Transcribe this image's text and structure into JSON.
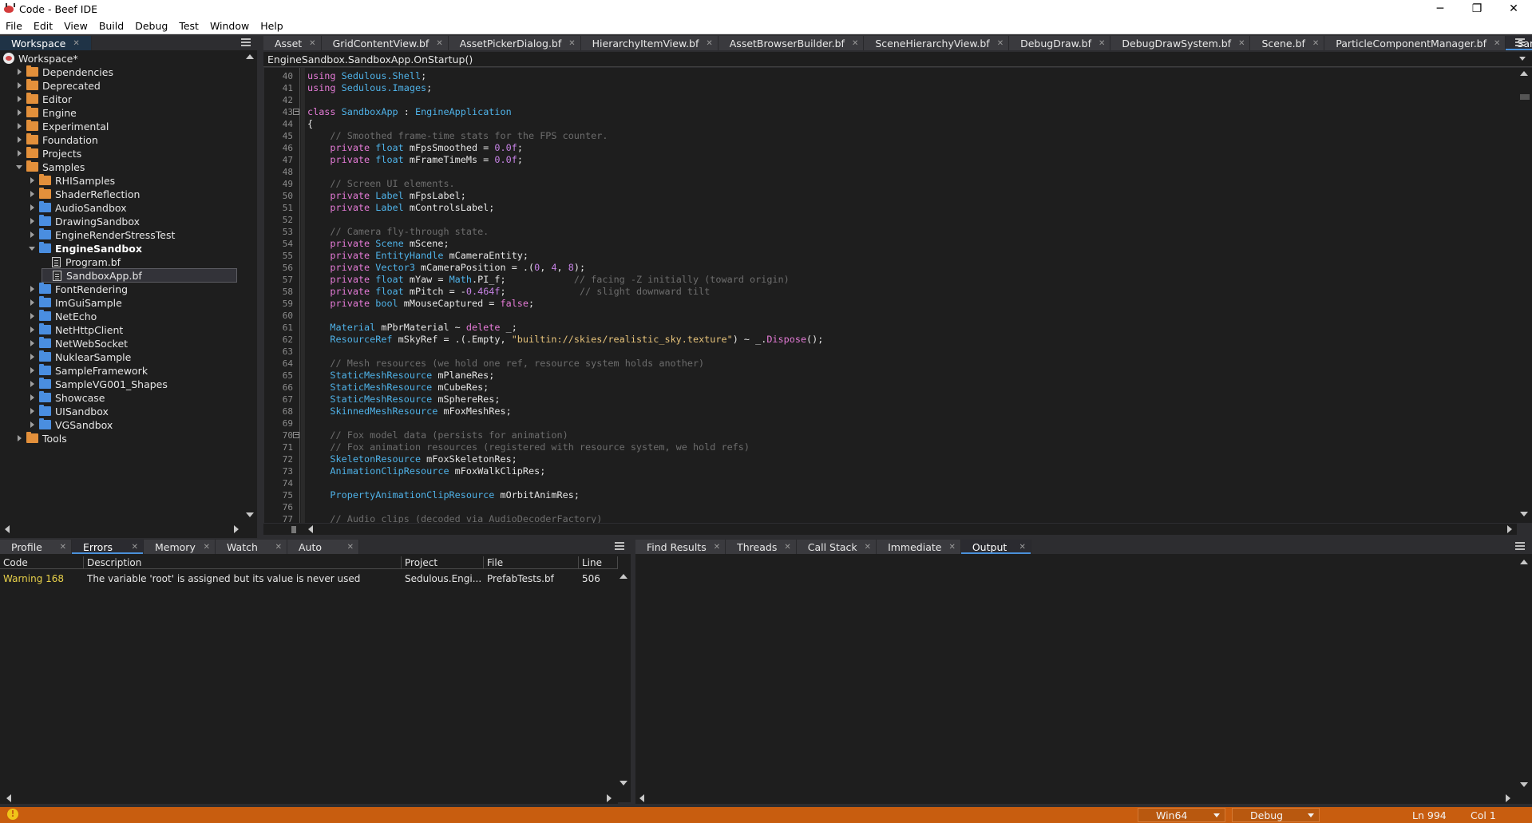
{
  "window": {
    "title": "Code - Beef IDE",
    "minimize": "─",
    "restore": "❐",
    "close": "✕"
  },
  "menu": [
    "File",
    "Edit",
    "View",
    "Build",
    "Debug",
    "Test",
    "Window",
    "Help"
  ],
  "workspace_tab": "Workspace",
  "tree": [
    {
      "label": "Workspace*",
      "icon": "workspace",
      "expanded": true
    },
    {
      "label": "Dependencies",
      "icon": "orange"
    },
    {
      "label": "Deprecated",
      "icon": "orange"
    },
    {
      "label": "Editor",
      "icon": "orange"
    },
    {
      "label": "Engine",
      "icon": "orange"
    },
    {
      "label": "Experimental",
      "icon": "orange"
    },
    {
      "label": "Foundation",
      "icon": "orange"
    },
    {
      "label": "Projects",
      "icon": "orange"
    },
    {
      "label": "Samples",
      "icon": "orange",
      "expanded": true
    },
    {
      "label": "RHISamples",
      "icon": "orange"
    },
    {
      "label": "ShaderReflection",
      "icon": "orange"
    },
    {
      "label": "AudioSandbox",
      "icon": "blue"
    },
    {
      "label": "DrawingSandbox",
      "icon": "blue"
    },
    {
      "label": "EngineRenderStressTest",
      "icon": "blue"
    },
    {
      "label": "EngineSandbox",
      "icon": "blue",
      "expanded": true,
      "bold": true
    },
    {
      "label": "Program.bf",
      "icon": "file"
    },
    {
      "label": "SandboxApp.bf",
      "icon": "file",
      "selected": true
    },
    {
      "label": "FontRendering",
      "icon": "blue"
    },
    {
      "label": "ImGuiSample",
      "icon": "blue"
    },
    {
      "label": "NetEcho",
      "icon": "blue"
    },
    {
      "label": "NetHttpClient",
      "icon": "blue"
    },
    {
      "label": "NetWebSocket",
      "icon": "blue"
    },
    {
      "label": "NuklearSample",
      "icon": "blue"
    },
    {
      "label": "SampleFramework",
      "icon": "blue"
    },
    {
      "label": "SampleVG001_Shapes",
      "icon": "blue"
    },
    {
      "label": "Showcase",
      "icon": "blue"
    },
    {
      "label": "UISandbox",
      "icon": "blue"
    },
    {
      "label": "VGSandbox",
      "icon": "blue"
    },
    {
      "label": "Tools",
      "icon": "orange"
    }
  ],
  "editor_tabs": [
    "Asset",
    "GridContentView.bf",
    "AssetPickerDialog.bf",
    "HierarchyItemView.bf",
    "AssetBrowserBuilder.bf",
    "SceneHierarchyView.bf",
    "DebugDraw.bf",
    "DebugDrawSystem.bf",
    "Scene.bf",
    "ParticleComponentManager.bf",
    "SandboxApp.bf"
  ],
  "breadcrumb": "EngineSandbox.SandboxApp.OnStartup()",
  "code": [
    {
      "n": "40",
      "t": [
        [
          "kw",
          "using "
        ],
        [
          "ty",
          "Sedulous.Shell"
        ],
        [
          "",
          "; "
        ]
      ]
    },
    {
      "n": "41",
      "t": [
        [
          "kw",
          "using "
        ],
        [
          "ty",
          "Sedulous.Images"
        ],
        [
          "",
          ";"
        ]
      ]
    },
    {
      "n": "42",
      "t": []
    },
    {
      "n": "43",
      "fold": true,
      "t": [
        [
          "kw",
          "class "
        ],
        [
          "ty",
          "SandboxApp"
        ],
        [
          "",
          " : "
        ],
        [
          "ty",
          "EngineApplication"
        ]
      ]
    },
    {
      "n": "44",
      "t": [
        [
          "",
          "{"
        ]
      ]
    },
    {
      "n": "45",
      "t": [
        [
          "cm",
          "    // Smoothed frame-time stats for the FPS counter."
        ]
      ]
    },
    {
      "n": "46",
      "t": [
        [
          "kw",
          "    private "
        ],
        [
          "ty",
          "float"
        ],
        [
          "",
          " mFpsSmoothed = "
        ],
        [
          "nm",
          "0.0f"
        ],
        [
          "",
          ";"
        ]
      ]
    },
    {
      "n": "47",
      "t": [
        [
          "kw",
          "    private "
        ],
        [
          "ty",
          "float"
        ],
        [
          "",
          " mFrameTimeMs = "
        ],
        [
          "nm",
          "0.0f"
        ],
        [
          "",
          ";"
        ]
      ]
    },
    {
      "n": "48",
      "t": []
    },
    {
      "n": "49",
      "t": [
        [
          "cm",
          "    // Screen UI elements."
        ]
      ]
    },
    {
      "n": "50",
      "t": [
        [
          "kw",
          "    private "
        ],
        [
          "ty",
          "Label"
        ],
        [
          "",
          " mFpsLabel;"
        ]
      ]
    },
    {
      "n": "51",
      "t": [
        [
          "kw",
          "    private "
        ],
        [
          "ty",
          "Label"
        ],
        [
          "",
          " mControlsLabel;"
        ]
      ]
    },
    {
      "n": "52",
      "t": []
    },
    {
      "n": "53",
      "t": [
        [
          "cm",
          "    // Camera fly-through state."
        ]
      ]
    },
    {
      "n": "54",
      "t": [
        [
          "kw",
          "    private "
        ],
        [
          "ty",
          "Scene"
        ],
        [
          "",
          " mScene;"
        ]
      ]
    },
    {
      "n": "55",
      "t": [
        [
          "kw",
          "    private "
        ],
        [
          "ty",
          "EntityHandle"
        ],
        [
          "",
          " mCameraEntity;"
        ]
      ]
    },
    {
      "n": "56",
      "t": [
        [
          "kw",
          "    private "
        ],
        [
          "ty",
          "Vector3"
        ],
        [
          "",
          " mCameraPosition = .("
        ],
        [
          "nm",
          "0"
        ],
        [
          "",
          ", "
        ],
        [
          "nm",
          "4"
        ],
        [
          "",
          ", "
        ],
        [
          "nm",
          "8"
        ],
        [
          "",
          ");"
        ]
      ]
    },
    {
      "n": "57",
      "t": [
        [
          "kw",
          "    private "
        ],
        [
          "ty",
          "float"
        ],
        [
          "",
          " mYaw = "
        ],
        [
          "ty",
          "Math"
        ],
        [
          "",
          ".PI_f;"
        ],
        [
          "cm",
          "            // facing -Z initially (toward origin)"
        ]
      ]
    },
    {
      "n": "58",
      "t": [
        [
          "kw",
          "    private "
        ],
        [
          "ty",
          "float"
        ],
        [
          "",
          " mPitch = -"
        ],
        [
          "nm",
          "0.464f"
        ],
        [
          "",
          ";"
        ],
        [
          "cm",
          "             // slight downward tilt"
        ]
      ]
    },
    {
      "n": "59",
      "t": [
        [
          "kw",
          "    private "
        ],
        [
          "ty",
          "bool"
        ],
        [
          "",
          " mMouseCaptured = "
        ],
        [
          "kw",
          "false"
        ],
        [
          "",
          ";"
        ]
      ]
    },
    {
      "n": "60",
      "t": []
    },
    {
      "n": "61",
      "t": [
        [
          "ty",
          "    Material"
        ],
        [
          "",
          " mPbrMaterial ~ "
        ],
        [
          "kw",
          "delete"
        ],
        [
          "",
          " _;"
        ]
      ]
    },
    {
      "n": "62",
      "t": [
        [
          "ty",
          "    ResourceRef"
        ],
        [
          "",
          " mSkyRef = .(.Empty, "
        ],
        [
          "st",
          "\"builtin://skies/realistic_sky.texture\""
        ],
        [
          "",
          ") ~ _."
        ],
        [
          "kw",
          "Dispose"
        ],
        [
          "",
          "();"
        ]
      ]
    },
    {
      "n": "63",
      "t": []
    },
    {
      "n": "64",
      "t": [
        [
          "cm",
          "    // Mesh resources (we hold one ref, resource system holds another)"
        ]
      ]
    },
    {
      "n": "65",
      "t": [
        [
          "ty",
          "    StaticMeshResource"
        ],
        [
          "",
          " mPlaneRes;"
        ]
      ]
    },
    {
      "n": "66",
      "t": [
        [
          "ty",
          "    StaticMeshResource"
        ],
        [
          "",
          " mCubeRes;"
        ]
      ]
    },
    {
      "n": "67",
      "t": [
        [
          "ty",
          "    StaticMeshResource"
        ],
        [
          "",
          " mSphereRes;"
        ]
      ]
    },
    {
      "n": "68",
      "t": [
        [
          "ty",
          "    SkinnedMeshResource"
        ],
        [
          "",
          " mFoxMeshRes;"
        ]
      ]
    },
    {
      "n": "69",
      "t": []
    },
    {
      "n": "70",
      "fold": true,
      "t": [
        [
          "cm",
          "    // Fox model data (persists for animation)"
        ]
      ]
    },
    {
      "n": "71",
      "t": [
        [
          "cm",
          "    // Fox animation resources (registered with resource system, we hold refs)"
        ]
      ]
    },
    {
      "n": "72",
      "t": [
        [
          "ty",
          "    SkeletonResource"
        ],
        [
          "",
          " mFoxSkeletonRes;"
        ]
      ]
    },
    {
      "n": "73",
      "t": [
        [
          "ty",
          "    AnimationClipResource"
        ],
        [
          "",
          " mFoxWalkClipRes;"
        ]
      ]
    },
    {
      "n": "74",
      "t": []
    },
    {
      "n": "75",
      "t": [
        [
          "ty",
          "    PropertyAnimationClipResource"
        ],
        [
          "",
          " mOrbitAnimRes;"
        ]
      ]
    },
    {
      "n": "76",
      "t": []
    },
    {
      "n": "77",
      "t": [
        [
          "cm",
          "    // Audio clips (decoded via AudioDecoderFactory)"
        ]
      ]
    }
  ],
  "bottom_left_tabs": [
    "Profile",
    "Errors",
    "Memory",
    "Watch",
    "Auto"
  ],
  "errors_columns": [
    "Code",
    "Description",
    "Project",
    "File",
    "Line"
  ],
  "errors_rows": [
    {
      "code": "Warning 168",
      "description": "The variable 'root' is assigned but its value is never used",
      "project": "Sedulous.Engi...",
      "file": "PrefabTests.bf",
      "line": "506"
    }
  ],
  "bottom_right_tabs": [
    "Find Results",
    "Threads",
    "Call Stack",
    "Immediate",
    "Output"
  ],
  "status": {
    "warning_icon": "!",
    "platform": "Win64",
    "config": "Debug",
    "line": "Ln 994",
    "col": "Col 1"
  },
  "colors": {
    "accent": "#4a90d9",
    "status_bar": "#c85d0f",
    "warning": "#e8d14a"
  }
}
